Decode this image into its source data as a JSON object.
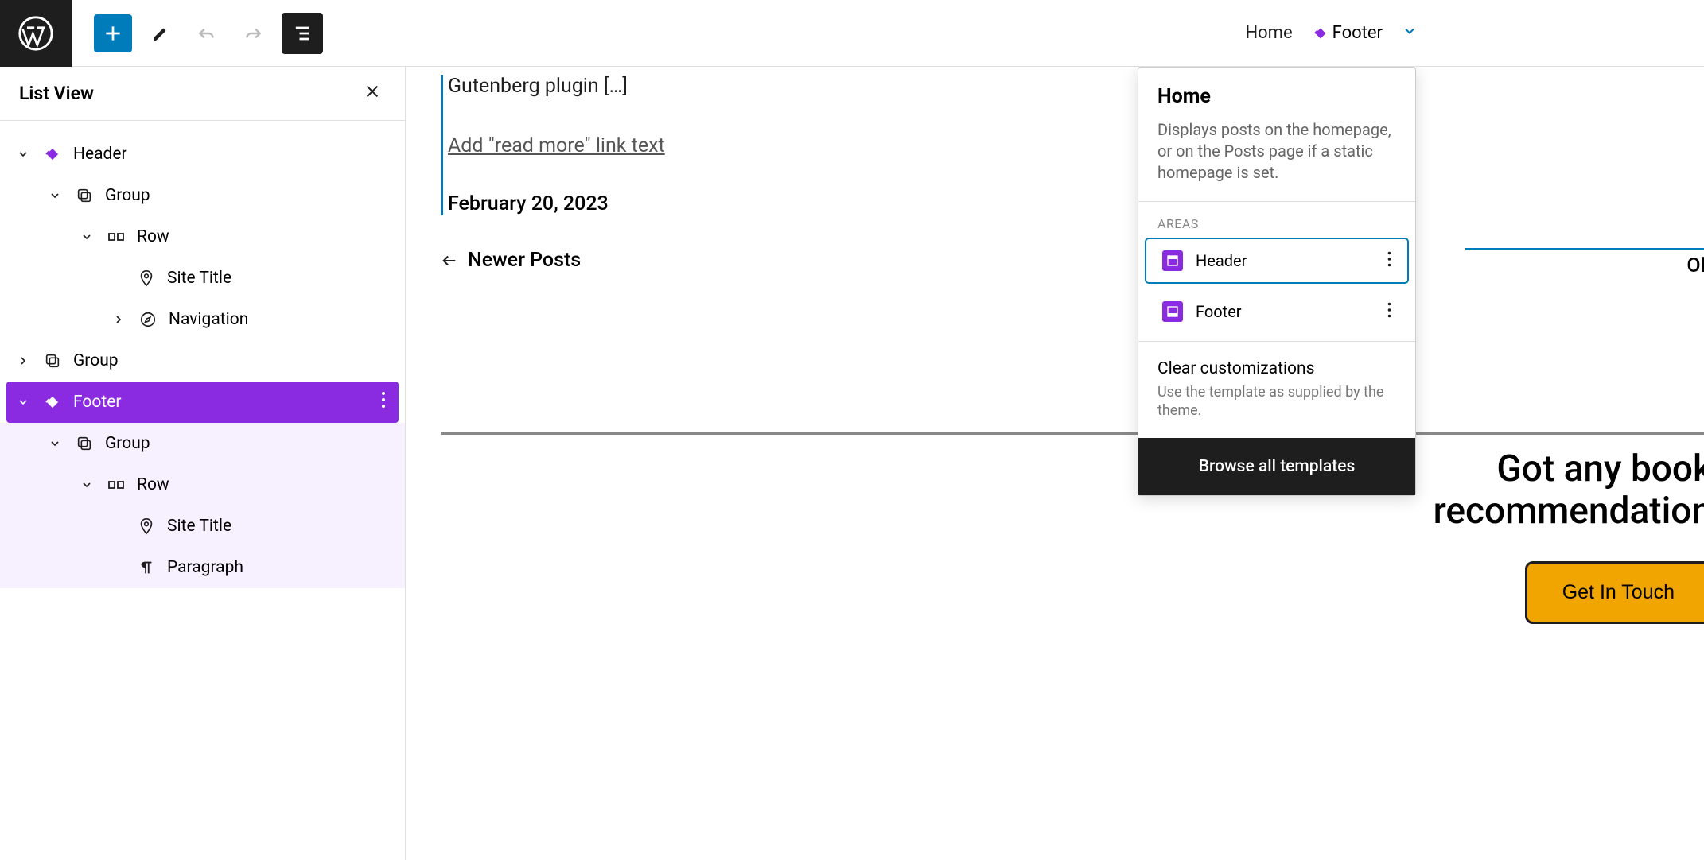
{
  "topbar": {
    "breadcrumb_home": "Home",
    "breadcrumb_current": "Footer"
  },
  "sidebar": {
    "title": "List View",
    "tree": {
      "header": "Header",
      "group1": "Group",
      "row1": "Row",
      "site_title1": "Site Title",
      "navigation": "Navigation",
      "group2": "Group",
      "footer": "Footer",
      "group3": "Group",
      "row2": "Row",
      "site_title2": "Site Title",
      "paragraph": "Paragraph"
    }
  },
  "canvas": {
    "post_title": "Gutenberg plugin […]",
    "read_more": "Add \"read more\" link text",
    "post_date": "February 20, 2023",
    "newer_posts": "Newer Posts",
    "ol_text": "Ol",
    "cta_title": "Got any book recommendation",
    "cta_button": "Get In Touch"
  },
  "popover": {
    "title": "Home",
    "description": "Displays posts on the homepage, or on the Posts page if a static homepage is set.",
    "areas_label": "Areas",
    "area_header": "Header",
    "area_footer": "Footer",
    "clear_title": "Clear customizations",
    "clear_desc": "Use the template as supplied by the theme.",
    "browse": "Browse all templates"
  }
}
